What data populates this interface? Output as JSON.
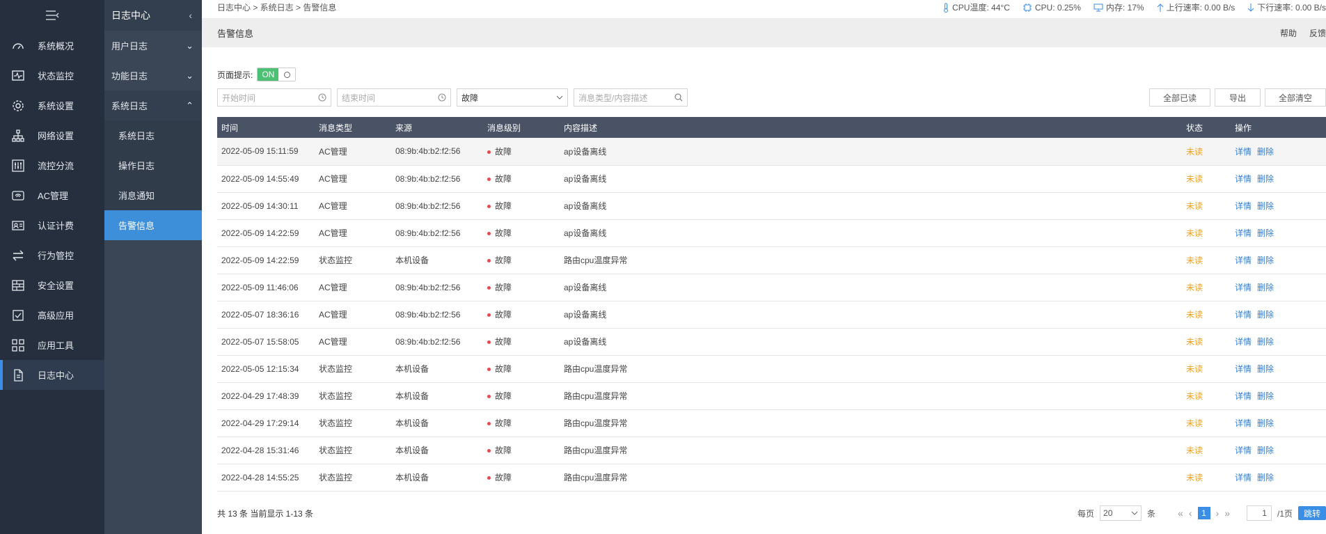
{
  "sidebar": {
    "items": [
      {
        "label": "系统概况",
        "icon": "dashboard-icon"
      },
      {
        "label": "状态监控",
        "icon": "monitor-icon"
      },
      {
        "label": "系统设置",
        "icon": "gear-icon"
      },
      {
        "label": "网络设置",
        "icon": "network-icon"
      },
      {
        "label": "流控分流",
        "icon": "sliders-icon"
      },
      {
        "label": "AC管理",
        "icon": "wifi-icon"
      },
      {
        "label": "认证计费",
        "icon": "id-card-icon"
      },
      {
        "label": "行为管控",
        "icon": "arrows-icon"
      },
      {
        "label": "安全设置",
        "icon": "firewall-icon"
      },
      {
        "label": "高级应用",
        "icon": "note-icon"
      },
      {
        "label": "应用工具",
        "icon": "apps-icon"
      },
      {
        "label": "日志中心",
        "icon": "file-icon"
      }
    ]
  },
  "subnav": {
    "title": "日志中心",
    "groups": [
      "用户日志",
      "功能日志",
      "系统日志"
    ],
    "subs": [
      "系统日志",
      "操作日志",
      "消息通知",
      "告警信息"
    ]
  },
  "topbar": {
    "breadcrumb": "日志中心 > 系统日志 > 告警信息",
    "cpu_temp": "CPU温度: 44°C",
    "cpu": "CPU: 0.25%",
    "mem": "内存: 17%",
    "up": "上行速率: 0.00 B/s",
    "down": "下行速率: 0.00 B/s"
  },
  "page": {
    "title": "告警信息",
    "help": "帮助",
    "feedback": "反馈",
    "hint_label": "页面提示:",
    "toggle_on": "ON"
  },
  "filters": {
    "start_placeholder": "开始时间",
    "end_placeholder": "结束时间",
    "level_value": "故障",
    "search_placeholder": "消息类型/内容描述"
  },
  "actions": {
    "read_all": "全部已读",
    "export": "导出",
    "clear_all": "全部清空"
  },
  "table": {
    "headers": [
      "时间",
      "消息类型",
      "来源",
      "消息级别",
      "内容描述",
      "状态",
      "操作"
    ],
    "detail": "详情",
    "delete": "删除",
    "rows": [
      {
        "time": "2022-05-09 15:11:59",
        "type": "AC管理",
        "src": "08:9b:4b:b2:f2:56",
        "level": "故障",
        "desc": "ap设备离线",
        "status": "未读"
      },
      {
        "time": "2022-05-09 14:55:49",
        "type": "AC管理",
        "src": "08:9b:4b:b2:f2:56",
        "level": "故障",
        "desc": "ap设备离线",
        "status": "未读"
      },
      {
        "time": "2022-05-09 14:30:11",
        "type": "AC管理",
        "src": "08:9b:4b:b2:f2:56",
        "level": "故障",
        "desc": "ap设备离线",
        "status": "未读"
      },
      {
        "time": "2022-05-09 14:22:59",
        "type": "AC管理",
        "src": "08:9b:4b:b2:f2:56",
        "level": "故障",
        "desc": "ap设备离线",
        "status": "未读"
      },
      {
        "time": "2022-05-09 14:22:59",
        "type": "状态监控",
        "src": "本机设备",
        "level": "故障",
        "desc": "路由cpu温度异常",
        "status": "未读"
      },
      {
        "time": "2022-05-09 11:46:06",
        "type": "AC管理",
        "src": "08:9b:4b:b2:f2:56",
        "level": "故障",
        "desc": "ap设备离线",
        "status": "未读"
      },
      {
        "time": "2022-05-07 18:36:16",
        "type": "AC管理",
        "src": "08:9b:4b:b2:f2:56",
        "level": "故障",
        "desc": "ap设备离线",
        "status": "未读"
      },
      {
        "time": "2022-05-07 15:58:05",
        "type": "AC管理",
        "src": "08:9b:4b:b2:f2:56",
        "level": "故障",
        "desc": "ap设备离线",
        "status": "未读"
      },
      {
        "time": "2022-05-05 12:15:34",
        "type": "状态监控",
        "src": "本机设备",
        "level": "故障",
        "desc": "路由cpu温度异常",
        "status": "未读"
      },
      {
        "time": "2022-04-29 17:48:39",
        "type": "状态监控",
        "src": "本机设备",
        "level": "故障",
        "desc": "路由cpu温度异常",
        "status": "未读"
      },
      {
        "time": "2022-04-29 17:29:14",
        "type": "状态监控",
        "src": "本机设备",
        "level": "故障",
        "desc": "路由cpu温度异常",
        "status": "未读"
      },
      {
        "time": "2022-04-28 15:31:46",
        "type": "状态监控",
        "src": "本机设备",
        "level": "故障",
        "desc": "路由cpu温度异常",
        "status": "未读"
      },
      {
        "time": "2022-04-28 14:55:25",
        "type": "状态监控",
        "src": "本机设备",
        "level": "故障",
        "desc": "路由cpu温度异常",
        "status": "未读"
      }
    ]
  },
  "footer": {
    "summary": "共 13 条 当前显示 1-13 条",
    "per_page_label": "每页",
    "per_page": "20",
    "unit": "条",
    "current_page": "1",
    "page_input": "1",
    "total_pages": "/1页",
    "jump": "跳转"
  },
  "colors": {
    "accent": "#3a8ee6",
    "unread": "#f0a020",
    "danger": "#e8484f",
    "toggle": "#4cc174"
  }
}
